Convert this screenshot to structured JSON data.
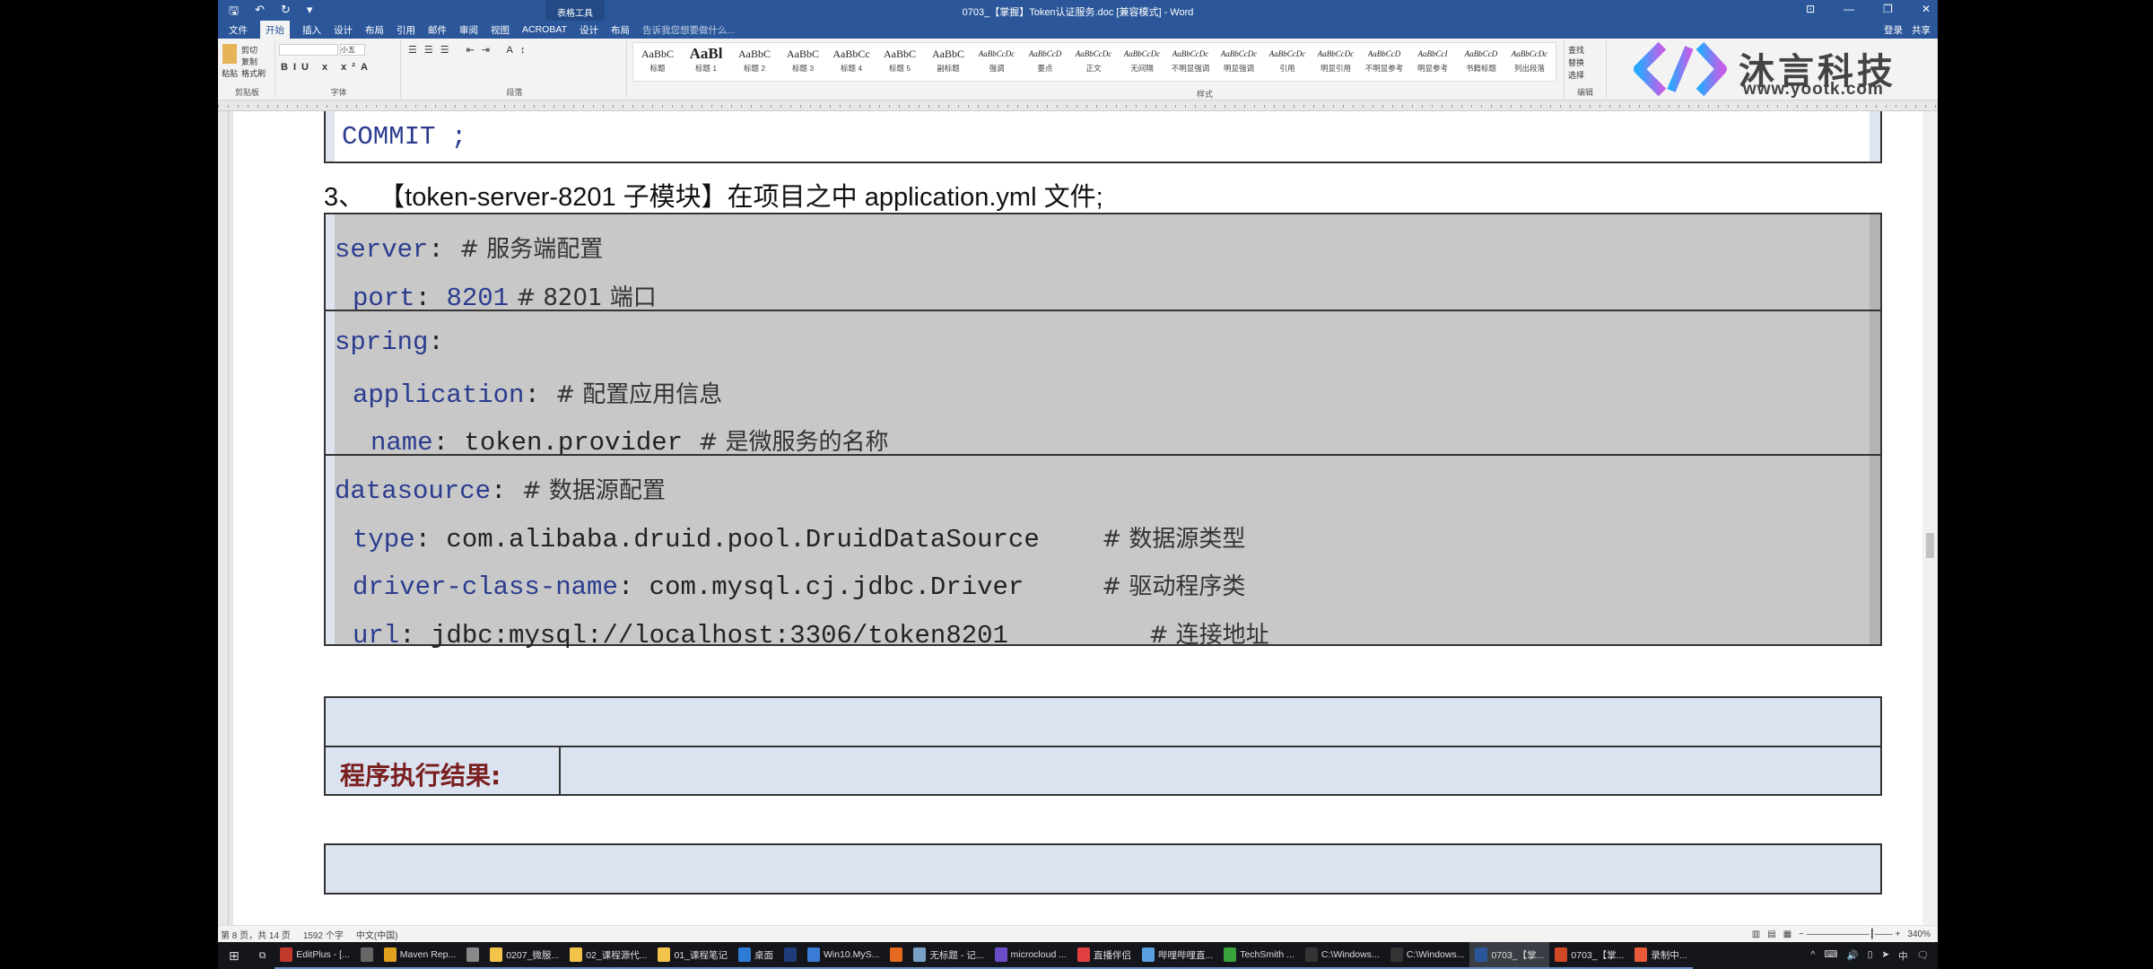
{
  "window": {
    "title": "0703_【掌握】Token认证服务.doc [兼容模式] - Word",
    "context_tool": "表格工具",
    "buttons": [
      "restore-ribbon",
      "minimize",
      "maximize",
      "close"
    ]
  },
  "qat": {
    "save": "🖫",
    "undo": "↶",
    "redo": "↻",
    "more": "▾"
  },
  "tabs": [
    "文件",
    "开始",
    "插入",
    "设计",
    "布局",
    "引用",
    "邮件",
    "审阅",
    "视图",
    "ACROBAT",
    "设计",
    "布局"
  ],
  "tell_me": "告诉我您想要做什么...",
  "account": {
    "login": "登录",
    "share": "共享"
  },
  "ribbon": {
    "clipboard": {
      "label": "剪贴板",
      "paste": "粘贴",
      "cut": "剪切",
      "copy": "复制",
      "format_painter": "格式刷"
    },
    "font": {
      "label": "字体",
      "size": "小五"
    },
    "paragraph": {
      "label": "段落"
    },
    "styles": {
      "label": "样式",
      "items": [
        {
          "sample": "AaBbC",
          "name": "标题"
        },
        {
          "sample": "AaBl",
          "name": "标题 1"
        },
        {
          "sample": "AaBbC",
          "name": "标题 2"
        },
        {
          "sample": "AaBbC",
          "name": "标题 3"
        },
        {
          "sample": "AaBbCc",
          "name": "标题 4"
        },
        {
          "sample": "AaBbC",
          "name": "标题 5"
        },
        {
          "sample": "AaBbC",
          "name": "副标题"
        },
        {
          "sample": "AaBbCcDc",
          "name": "强调"
        },
        {
          "sample": "AaBbCcD",
          "name": "要点"
        },
        {
          "sample": "AaBbCcDc",
          "name": "正文"
        },
        {
          "sample": "AaBbCcDc",
          "name": "无间隔"
        },
        {
          "sample": "AaBbCcDc",
          "name": "不明显强调"
        },
        {
          "sample": "AaBbCcDc",
          "name": "明显强调"
        },
        {
          "sample": "AaBbCcDc",
          "name": "引用"
        },
        {
          "sample": "AaBbCcDc",
          "name": "明显引用"
        },
        {
          "sample": "AaBbCcD",
          "name": "不明显参考"
        },
        {
          "sample": "AaBbCcI",
          "name": "明显参考"
        },
        {
          "sample": "AaBbCcD",
          "name": "书籍标题"
        },
        {
          "sample": "AaBbCcDc",
          "name": "列出段落"
        }
      ]
    },
    "editing": {
      "label": "编辑",
      "find": "查找",
      "replace": "替换",
      "select": "选择"
    }
  },
  "watermark": {
    "brand": "沐言科技",
    "url": "www.yootk.com"
  },
  "document": {
    "commit": "COMMIT ;",
    "heading": "3、  【token-server-8201 子模块】在项目之中 application.yml 文件;",
    "code": [
      {
        "indent": 0,
        "key": "server",
        "rest": ": ",
        "comment": "# 服务端配置"
      },
      {
        "indent": 1,
        "key": "port",
        "rest": ": ",
        "num": "8201",
        "comment": " # 8201 端口"
      },
      {
        "indent": 0,
        "key": "spring",
        "rest": ":",
        "comment": ""
      },
      {
        "indent": 1,
        "key": "application",
        "rest": ": ",
        "comment": "# 配置应用信息"
      },
      {
        "indent": 2,
        "key": "name",
        "rest": ": token.provider ",
        "comment": "# 是微服务的名称"
      },
      {
        "indent": 0,
        "key": "datasource",
        "rest": ": ",
        "comment": "# 数据源配置"
      },
      {
        "indent": 1,
        "key": "type",
        "rest": ": com.alibaba.druid.pool.DruidDataSource    ",
        "comment": "# 数据源类型"
      },
      {
        "indent": 1,
        "key": "driver-class-name",
        "rest": ": com.mysql.cj.jdbc.Driver     ",
        "comment": "# 驱动程序类"
      },
      {
        "indent": 1,
        "key": "url",
        "rest": ": jdbc:mysql://localhost:3306/token8201         ",
        "comment": "# 连接地址"
      }
    ],
    "result_label": "程序执行结果:"
  },
  "status": {
    "page": "第 8 页，共 14 页",
    "words": "1592 个字",
    "lang": "中文(中国)",
    "zoom": "340%"
  },
  "taskbar": {
    "items": [
      {
        "label": "EditPlus - [...",
        "color": "#c0392b"
      },
      {
        "label": "",
        "color": "#666"
      },
      {
        "label": "Maven Rep...",
        "color": "#e0a020"
      },
      {
        "label": "",
        "color": "#888"
      },
      {
        "label": "0207_微服...",
        "color": "#f2c44b"
      },
      {
        "label": "02_课程源代...",
        "color": "#f2c44b"
      },
      {
        "label": "01_课程笔记",
        "color": "#f2c44b"
      },
      {
        "label": "桌面",
        "color": "#2d7bd6"
      },
      {
        "label": "",
        "color": "#1f3b7a"
      },
      {
        "label": "Win10.MyS...",
        "color": "#3a7bd5"
      },
      {
        "label": "",
        "color": "#e66a1f"
      },
      {
        "label": "无标题 - 记...",
        "color": "#7aa0c8"
      },
      {
        "label": "microcloud ...",
        "color": "#6a4cc8"
      },
      {
        "label": "直播伴侣",
        "color": "#e04040"
      },
      {
        "label": "哔哩哔哩直...",
        "color": "#5aa0e0"
      },
      {
        "label": "TechSmith ...",
        "color": "#3aa23a"
      },
      {
        "label": "C:\\Windows...",
        "color": "#333"
      },
      {
        "label": "C:\\Windows...",
        "color": "#333"
      },
      {
        "label": "0703_【掌...",
        "color": "#2b579a",
        "active": true
      },
      {
        "label": "0703_【掌...",
        "color": "#d24726"
      },
      {
        "label": "录制中...",
        "color": "#e85a3a"
      }
    ],
    "tray": [
      "^",
      "⌨",
      "🔊",
      "▯",
      "➤",
      "中",
      "🗨"
    ]
  }
}
